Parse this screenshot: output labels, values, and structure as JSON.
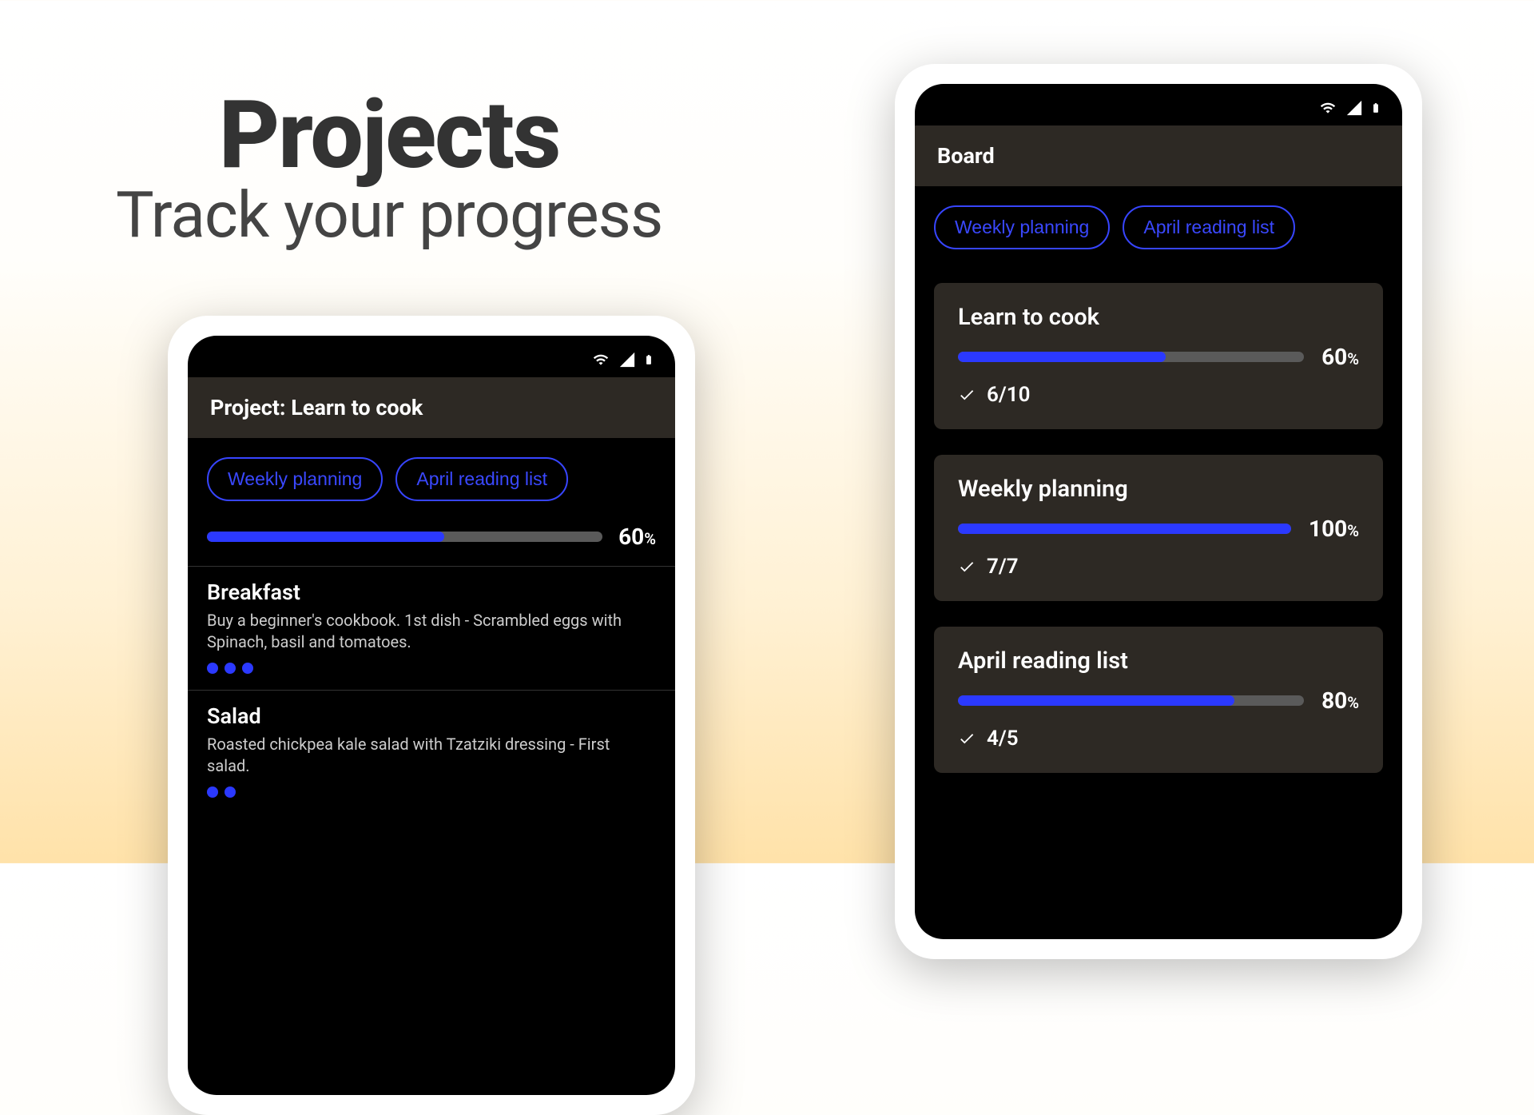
{
  "hero": {
    "title": "Projects",
    "subtitle": "Track your progress"
  },
  "phone_left": {
    "appbar_title": "Project: Learn to cook",
    "chips": [
      "Weekly planning",
      "April reading list"
    ],
    "progress_pct": "60",
    "progress_fill_pct": 60,
    "tasks": [
      {
        "title": "Breakfast",
        "desc": "Buy a beginner's cookbook. 1st dish - Scrambled eggs with Spinach, basil and tomatoes.",
        "dots": 3
      },
      {
        "title": "Salad",
        "desc": "Roasted chickpea kale salad with Tzatziki dressing - First salad.",
        "dots": 2
      }
    ]
  },
  "phone_right": {
    "appbar_title": "Board",
    "chips": [
      "Weekly planning",
      "April reading list"
    ],
    "cards": [
      {
        "title": "Learn to cook",
        "pct": "60",
        "fill": 60,
        "count": "6/10"
      },
      {
        "title": "Weekly planning",
        "pct": "100",
        "fill": 100,
        "count": "7/7"
      },
      {
        "title": "April reading list",
        "pct": "80",
        "fill": 80,
        "count": "4/5"
      }
    ]
  }
}
